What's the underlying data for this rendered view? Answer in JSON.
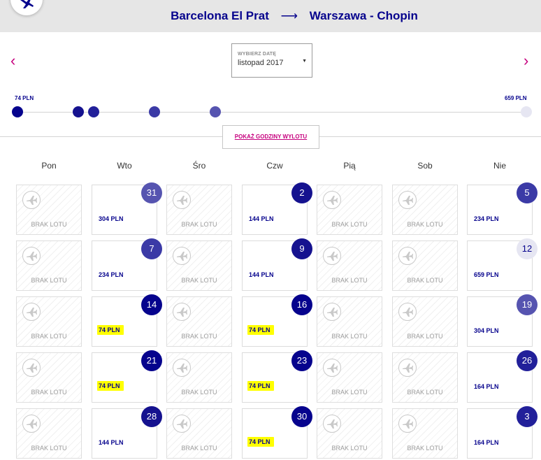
{
  "header": {
    "origin": "Barcelona El Prat",
    "arrow": "⟶",
    "destination": "Warszawa - Chopin"
  },
  "nav": {
    "prev": "‹",
    "next": "›"
  },
  "date_picker": {
    "label": "WYBIERZ DATĘ",
    "value": "listopad 2017",
    "caret": "▼"
  },
  "price_range": {
    "min_label": "74 PLN",
    "max_label": "659 PLN",
    "dots": [
      {
        "price": 74,
        "color": "#06038d"
      },
      {
        "price": 144,
        "color": "#15128f"
      },
      {
        "price": 164,
        "color": "#22209a"
      },
      {
        "price": 234,
        "color": "#3b3aa6"
      },
      {
        "price": 304,
        "color": "#5654b0"
      },
      {
        "price": 659,
        "color": "#e6e6f2"
      }
    ]
  },
  "show_hours_label": "POKAŻ GODZINY WYLOTU",
  "weekdays": [
    "Pon",
    "Wto",
    "Śro",
    "Czw",
    "Pią",
    "Sob",
    "Nie"
  ],
  "no_flight_label": "BRAK LOTU",
  "calendar": [
    [
      {
        "empty": true
      },
      {
        "day": "31",
        "price": "304 PLN",
        "color": "#5654b0"
      },
      {
        "empty": true
      },
      {
        "day": "2",
        "price": "144 PLN",
        "color": "#15128f"
      },
      {
        "empty": true
      },
      {
        "empty": true
      },
      {
        "day": "5",
        "price": "234 PLN",
        "color": "#3b3aa6"
      }
    ],
    [
      {
        "empty": true
      },
      {
        "day": "7",
        "price": "234 PLN",
        "color": "#3b3aa6"
      },
      {
        "empty": true
      },
      {
        "day": "9",
        "price": "144 PLN",
        "color": "#15128f"
      },
      {
        "empty": true
      },
      {
        "empty": true
      },
      {
        "day": "12",
        "price": "659 PLN",
        "color": "#e6e6f2",
        "text_color": "#06038d"
      }
    ],
    [
      {
        "empty": true
      },
      {
        "day": "14",
        "price": "74 PLN",
        "color": "#06038d",
        "highlight": true
      },
      {
        "empty": true
      },
      {
        "day": "16",
        "price": "74 PLN",
        "color": "#06038d",
        "highlight": true
      },
      {
        "empty": true
      },
      {
        "empty": true
      },
      {
        "day": "19",
        "price": "304 PLN",
        "color": "#5654b0"
      }
    ],
    [
      {
        "empty": true
      },
      {
        "day": "21",
        "price": "74 PLN",
        "color": "#06038d",
        "highlight": true
      },
      {
        "empty": true
      },
      {
        "day": "23",
        "price": "74 PLN",
        "color": "#06038d",
        "highlight": true
      },
      {
        "empty": true
      },
      {
        "empty": true
      },
      {
        "day": "26",
        "price": "164 PLN",
        "color": "#22209a"
      }
    ],
    [
      {
        "empty": true
      },
      {
        "day": "28",
        "price": "144 PLN",
        "color": "#15128f"
      },
      {
        "empty": true
      },
      {
        "day": "30",
        "price": "74 PLN",
        "color": "#06038d",
        "highlight": true
      },
      {
        "empty": true
      },
      {
        "empty": true
      },
      {
        "day": "3",
        "price": "164 PLN",
        "color": "#22209a"
      }
    ]
  ],
  "colors": {
    "brand": "#06038d",
    "accent": "#c6007e",
    "highlight": "#ffff00"
  },
  "icons": {
    "logo": "wizz-logo-icon",
    "plane": "plane-icon"
  }
}
